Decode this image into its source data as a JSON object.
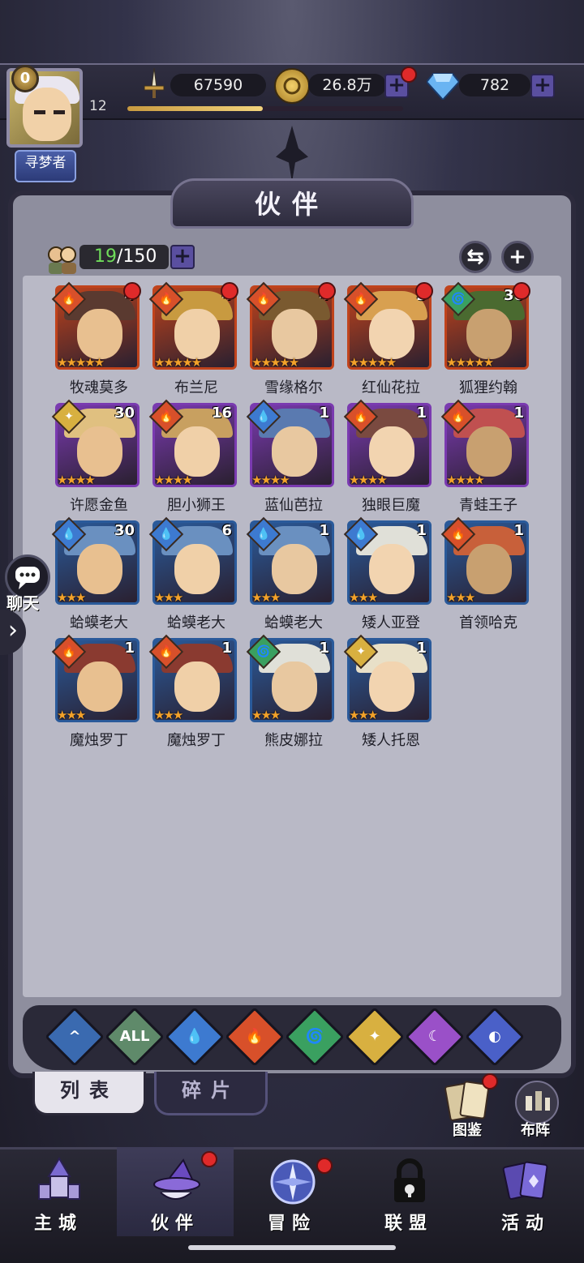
{
  "profile": {
    "level_badge": "0",
    "level": "12",
    "xp_fraction": 0.49,
    "title": "寻梦者"
  },
  "resources": {
    "power": "67590",
    "gold": "26.8万",
    "gems": "782"
  },
  "header": {
    "title": "伙伴"
  },
  "roster": {
    "current": "19",
    "max": "/150"
  },
  "partners": [
    {
      "name": "牧魂莫多",
      "level": "4",
      "element": "fire",
      "stars": 5,
      "rarity": "orange",
      "dot": true
    },
    {
      "name": "布兰尼",
      "level": "4",
      "element": "fire",
      "stars": 5,
      "rarity": "orange",
      "dot": true
    },
    {
      "name": "雪缘格尔",
      "level": "4",
      "element": "fire",
      "stars": 5,
      "rarity": "orange",
      "dot": true
    },
    {
      "name": "红仙花拉",
      "level": "3",
      "element": "fire",
      "stars": 5,
      "rarity": "orange",
      "dot": true
    },
    {
      "name": "狐狸约翰",
      "level": "30",
      "element": "wind",
      "stars": 5,
      "rarity": "orange",
      "dot": true
    },
    {
      "name": "许愿金鱼",
      "level": "30",
      "element": "light",
      "stars": 4,
      "rarity": "purple",
      "dot": false
    },
    {
      "name": "胆小狮王",
      "level": "16",
      "element": "fire",
      "stars": 4,
      "rarity": "purple",
      "dot": false
    },
    {
      "name": "蓝仙芭拉",
      "level": "1",
      "element": "water",
      "stars": 4,
      "rarity": "purple",
      "dot": false
    },
    {
      "name": "独眼巨魔",
      "level": "1",
      "element": "fire",
      "stars": 4,
      "rarity": "purple",
      "dot": false
    },
    {
      "name": "青蛙王子",
      "level": "1",
      "element": "fire",
      "stars": 4,
      "rarity": "purple",
      "dot": false
    },
    {
      "name": "蛤蟆老大",
      "level": "30",
      "element": "water",
      "stars": 3,
      "rarity": "blue",
      "dot": false
    },
    {
      "name": "蛤蟆老大",
      "level": "6",
      "element": "water",
      "stars": 3,
      "rarity": "blue",
      "dot": false
    },
    {
      "name": "蛤蟆老大",
      "level": "1",
      "element": "water",
      "stars": 3,
      "rarity": "blue",
      "dot": false
    },
    {
      "name": "矮人亚登",
      "level": "1",
      "element": "water",
      "stars": 3,
      "rarity": "blue",
      "dot": false
    },
    {
      "name": "首领哈克",
      "level": "1",
      "element": "fire",
      "stars": 3,
      "rarity": "blue",
      "dot": false
    },
    {
      "name": "魔烛罗丁",
      "level": "1",
      "element": "fire",
      "stars": 3,
      "rarity": "blue",
      "dot": false
    },
    {
      "name": "魔烛罗丁",
      "level": "1",
      "element": "fire",
      "stars": 3,
      "rarity": "blue",
      "dot": false
    },
    {
      "name": "熊皮娜拉",
      "level": "1",
      "element": "wind",
      "stars": 3,
      "rarity": "blue",
      "dot": false
    },
    {
      "name": "矮人托恩",
      "level": "1",
      "element": "light",
      "stars": 3,
      "rarity": "blue",
      "dot": false
    }
  ],
  "filters": [
    {
      "id": "top",
      "label": "",
      "color": "#3a6ab0"
    },
    {
      "id": "all",
      "label": "ALL",
      "color": "#5f8a6a"
    },
    {
      "id": "water",
      "label": "",
      "color": "#3d7ad0"
    },
    {
      "id": "fire",
      "label": "",
      "color": "#d8502a"
    },
    {
      "id": "wind",
      "label": "",
      "color": "#3aa060"
    },
    {
      "id": "light",
      "label": "",
      "color": "#d8b040"
    },
    {
      "id": "dark",
      "label": "",
      "color": "#9a50c8"
    },
    {
      "id": "planet",
      "label": "",
      "color": "#4a60c8"
    }
  ],
  "tabs": {
    "list": "列表",
    "shards": "碎片"
  },
  "side": {
    "collection": "图鉴",
    "formation": "布阵",
    "chat": "聊天"
  },
  "nav": {
    "city": "主城",
    "partner": "伙伴",
    "adventure": "冒险",
    "alliance": "联盟",
    "events": "活动"
  },
  "colors": {
    "fire": "#d8502a",
    "water": "#3d7ad0",
    "wind": "#3aa060",
    "light": "#d8b040",
    "orange": "#c0431c",
    "purple": "#7a3ab0",
    "blue": "#2a5a9a"
  }
}
